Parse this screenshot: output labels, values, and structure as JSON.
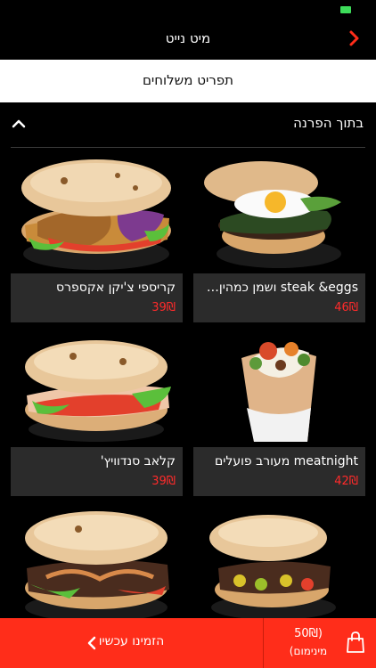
{
  "nav": {
    "title": "מיט נייט"
  },
  "tabbar": {
    "label": "תפריט משלוחים"
  },
  "category": {
    "title": "בתוך הפרנה"
  },
  "items": [
    {
      "name": "קריספי צ'יקן אקספרס",
      "price": "39₪"
    },
    {
      "name": "steak &eggs ושמן כמהין…",
      "price": "46₪"
    },
    {
      "name": "קלאב סנדוויץ'",
      "price": "39₪"
    },
    {
      "name": "meatnight מעורב פועלים",
      "price": "42₪"
    },
    {
      "name": "",
      "price": ""
    },
    {
      "name": "",
      "price": ""
    }
  ],
  "footer": {
    "order_label": "הזמינו עכשיו",
    "min_price": "(50₪",
    "min_label": "מינימום)"
  },
  "colors": {
    "accent": "#ff2d1a",
    "price": "#ff2b2b",
    "card_bg": "#2b2b2b",
    "status_battery": "#3ddc5a"
  },
  "icons": {
    "back": "chevron-right-icon",
    "collapse": "chevron-up-icon",
    "order": "chevron-left-icon",
    "cart": "shopping-bag-icon"
  }
}
